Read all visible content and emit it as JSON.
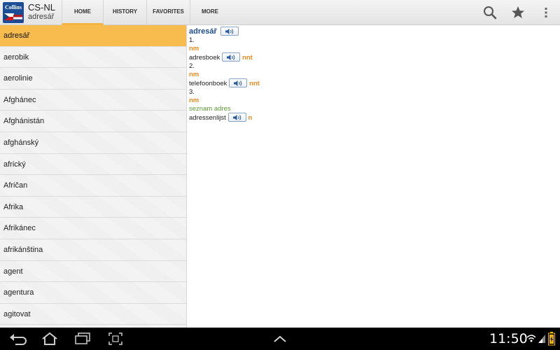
{
  "app": {
    "logo_text": "Collins",
    "title": "CS-NL",
    "subtitle": "adresář"
  },
  "tabs": [
    {
      "label": "HOME",
      "active": true
    },
    {
      "label": "HISTORY",
      "active": false
    },
    {
      "label": "FAVORITES",
      "active": false
    },
    {
      "label": "MORE",
      "active": false
    }
  ],
  "actions": {
    "search_icon": "search-icon",
    "favorite_icon": "star-icon",
    "overflow_icon": "overflow-menu-icon"
  },
  "wordlist": [
    "adresář",
    "aerobik",
    "aerolinie",
    "Afghánec",
    "Afghánistán",
    "afghánský",
    "africký",
    "Afričan",
    "Afrika",
    "Afrikánec",
    "afrikánština",
    "agent",
    "agentura",
    "agitovat"
  ],
  "selected_index": 0,
  "entry": {
    "headword": "adresář",
    "senses": [
      {
        "num": "1.",
        "pos": "nm",
        "gloss": "",
        "translation": "adresboek",
        "gender": "nnt"
      },
      {
        "num": "2.",
        "pos": "nm",
        "gloss": "",
        "translation": "telefoonboek",
        "gender": "nnt"
      },
      {
        "num": "3.",
        "pos": "nm",
        "gloss": "seznam adres",
        "translation": "adressenlijst",
        "gender": "n"
      }
    ]
  },
  "system": {
    "clock": "11:50"
  },
  "colors": {
    "accent": "#f7bc4d",
    "headword": "#1e4c8f",
    "pos": "#f08a1c",
    "gloss": "#5a9a32"
  }
}
